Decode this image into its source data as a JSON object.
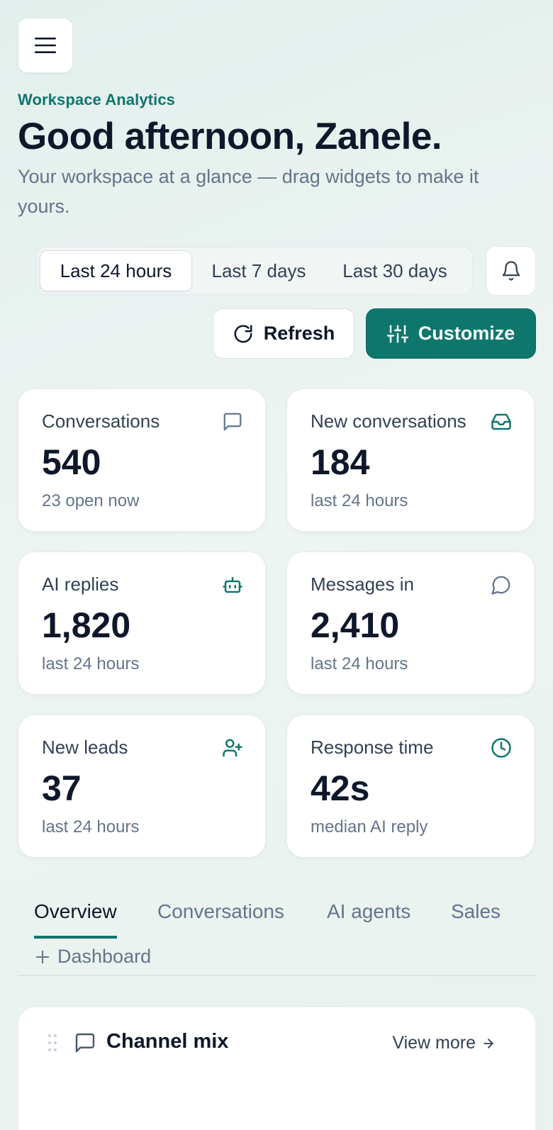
{
  "header": {
    "eyebrow": "Workspace Analytics",
    "title": "Good afternoon, Zanele.",
    "subtitle": "Your workspace at a glance — drag widgets to make it yours."
  },
  "range": {
    "options": [
      "Last 24 hours",
      "Last 7 days",
      "Last 30 days"
    ],
    "selected": "Last 24 hours"
  },
  "actions": {
    "refresh_label": "Refresh",
    "customize_label": "Customize"
  },
  "stats": [
    {
      "label": "Conversations",
      "value": "540",
      "sub": "23 open now",
      "icon": "message-square-icon"
    },
    {
      "label": "New conversations",
      "value": "184",
      "sub": "last 24 hours",
      "icon": "inbox-icon"
    },
    {
      "label": "AI replies",
      "value": "1,820",
      "sub": "last 24 hours",
      "icon": "bot-icon"
    },
    {
      "label": "Messages in",
      "value": "2,410",
      "sub": "last 24 hours",
      "icon": "message-circle-icon"
    },
    {
      "label": "New leads",
      "value": "37",
      "sub": "last 24 hours",
      "icon": "user-plus-icon"
    },
    {
      "label": "Response time",
      "value": "42s",
      "sub": "median AI reply",
      "icon": "clock-icon"
    }
  ],
  "tabs": {
    "items": [
      "Overview",
      "Conversations",
      "AI agents",
      "Sales"
    ],
    "active": "Overview",
    "add_label": "Dashboard"
  },
  "widget": {
    "title": "Channel mix",
    "more_label": "View more"
  },
  "colors": {
    "accent": "#0f766e",
    "text": "#0f172a",
    "muted": "#64748b"
  }
}
